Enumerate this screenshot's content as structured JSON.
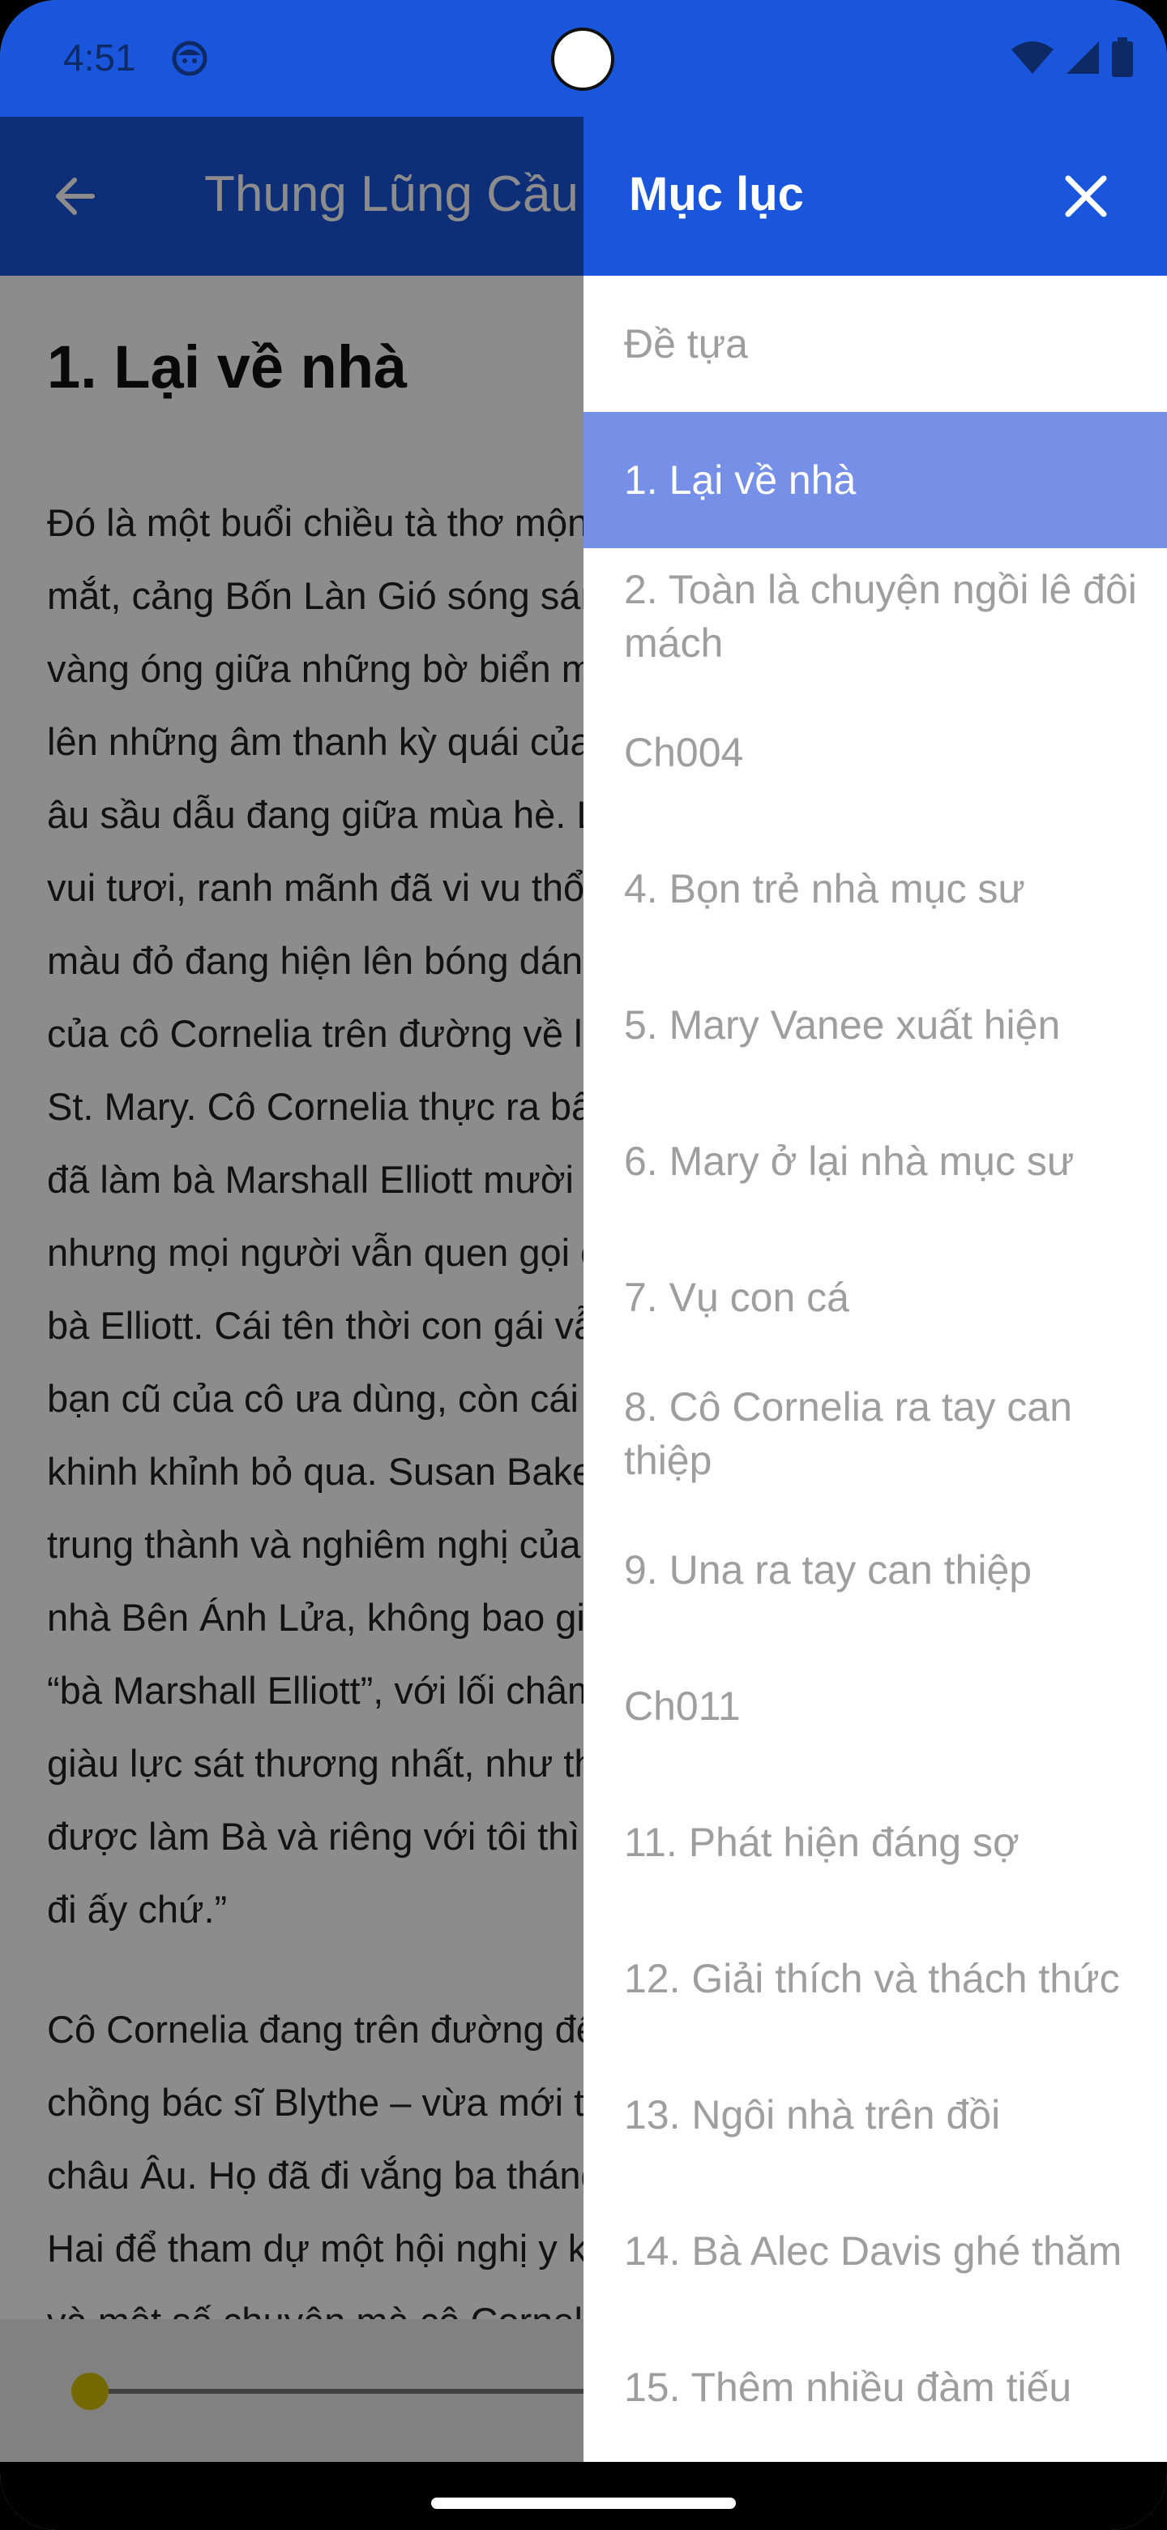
{
  "status_bar": {
    "time": "4:51",
    "icons": [
      "face-icon",
      "wifi-icon",
      "signal-icon",
      "battery-icon"
    ],
    "color": "#1a56db"
  },
  "app_bar": {
    "title": "Thung Lũng Cầu Vồng"
  },
  "content": {
    "chapter_title": "1. Lại về nhà",
    "paragraph1_lines": [
      "Đó là một buổi chiều tà thơ mộng, trước",
      "mắt, cảng Bốn Làn Gió sóng sánh ánh",
      "vàng óng giữa những bờ biển mù sương,",
      "lên những âm thanh kỳ quái của biển cả",
      "âu sầu dẫu đang giữa mùa hè. Lúc này,",
      "vui tươi, ranh mãnh đã vi vu thổi qua",
      "màu đỏ đang hiện lên bóng dáng quen thuộc",
      "của cô Cornelia trên đường về làng Glen",
      "St. Mary. Cô Cornelia thực ra bây giờ",
      "đã làm bà Marshall Elliott mười ba năm,",
      "nhưng mọi người vẫn quen gọi cô là",
      "bà Elliott. Cái tên thời con gái vẫn được",
      "bạn cũ của cô ưa dùng, còn cái kia thì",
      "khinh khỉnh bỏ qua. Susan Baker, người",
      "trung thành và nghiêm nghị của",
      "nhà Bên Ánh Lửa, không bao giờ gọi cô là",
      "“bà Marshall Elliott”, với lối châm biếm",
      "giàu lực sát thương nhất, như thể “cô ấy",
      "được làm Bà và riêng với tôi thì cứ để cô",
      "đi ấy chứ.”"
    ],
    "paragraph2_lines": [
      "Cô Cornelia đang trên đường đến gặp vợ",
      "chồng bác sĩ Blythe – vừa mới trở về từ",
      "châu Âu. Họ đã đi vắng ba tháng, ra đi từ",
      "Hai để tham dự một hội nghị y khoa ở",
      "và một số chuyện mà cô Cornelia"
    ]
  },
  "slider": {
    "value": 0.0
  },
  "drawer": {
    "title": "Mục lục",
    "active_index": 1,
    "items": [
      "Đề tựa",
      "1. Lại về nhà",
      "2. Toàn là chuyện ngồi lê đôi mách",
      "Ch004",
      "4. Bọn trẻ nhà mục sư",
      "5. Mary Vanee xuất hiện",
      "6. Mary ở lại nhà mục sư",
      "7. Vụ con cá",
      "8. Cô Cornelia ra tay can thiệp",
      "9. Una ra tay can thiệp",
      "Ch011",
      "11. Phát hiện đáng sợ",
      "12. Giải thích và thách thức",
      "13. Ngôi nhà trên đồi",
      "14. Bà Alec Davis ghé thăm",
      "15. Thêm nhiều đàm tiếu"
    ]
  },
  "colors": {
    "primary": "#1a56db",
    "active_item": "#7590e6",
    "inactive_text": "#9e9e9e",
    "slider_thumb": "#d4c000"
  }
}
